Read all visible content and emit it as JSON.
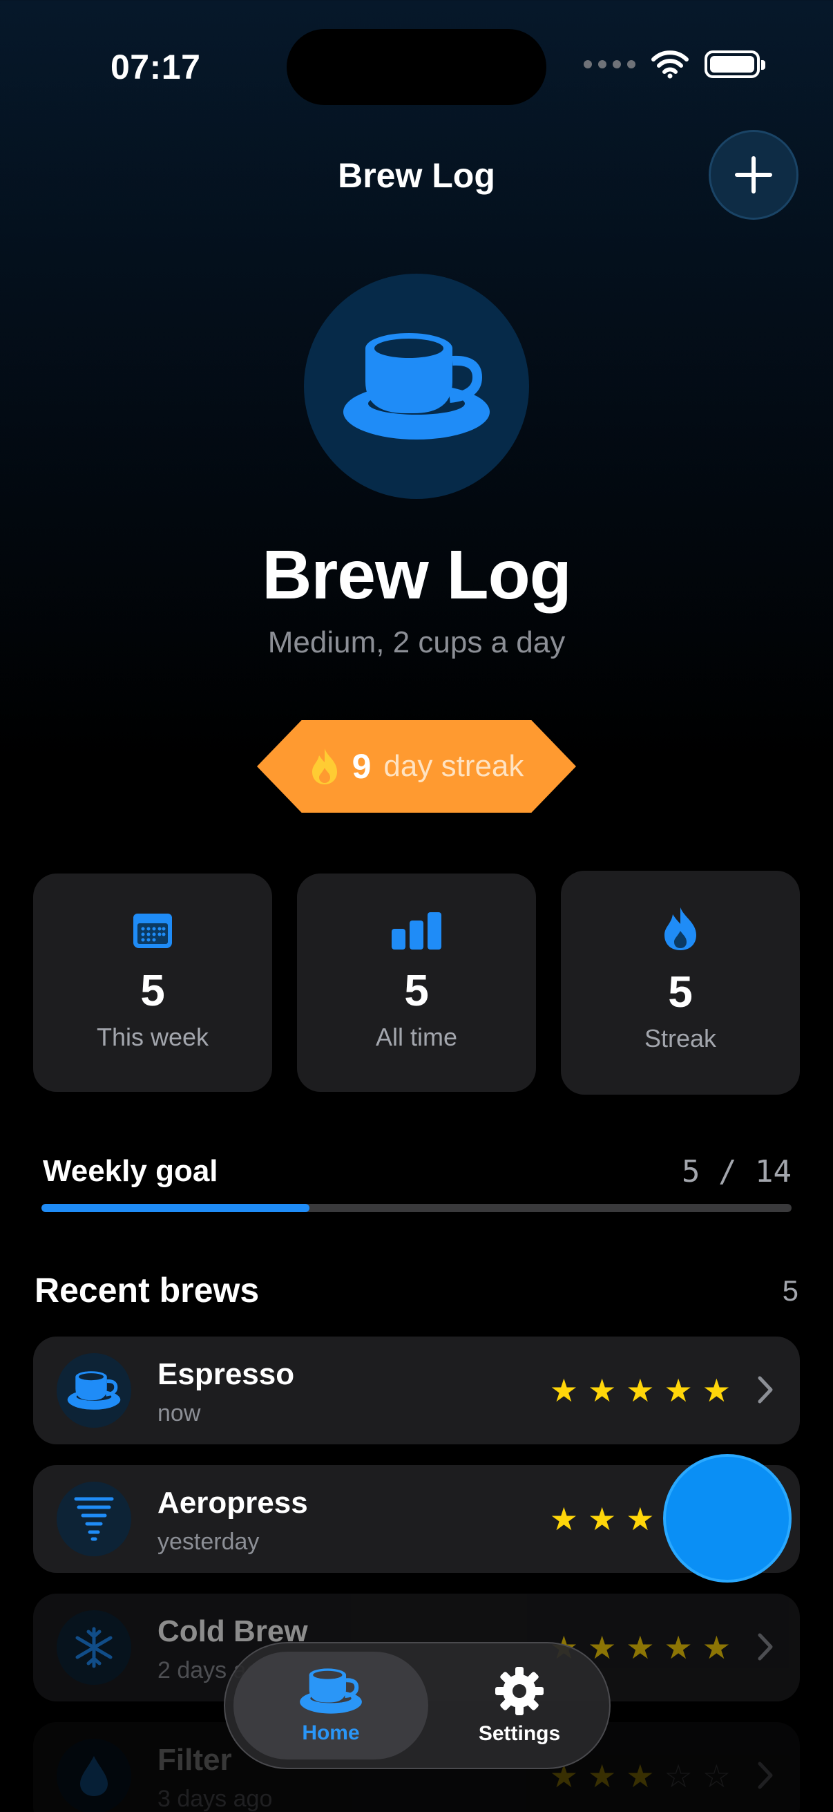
{
  "status_bar": {
    "time": "07:17"
  },
  "nav": {
    "title": "Brew Log",
    "add_icon": "plus-icon"
  },
  "hero": {
    "icon": "coffee-cup-icon",
    "title": "Brew Log",
    "subtitle": "Medium, 2 cups a day"
  },
  "streak_badge": {
    "icon": "flame-icon",
    "count": "9",
    "text": "day streak"
  },
  "stats": [
    {
      "icon": "calendar-icon",
      "value": "5",
      "label": "This week"
    },
    {
      "icon": "bar-chart-icon",
      "value": "5",
      "label": "All time"
    },
    {
      "icon": "flame-icon",
      "value": "5",
      "label": "Streak"
    }
  ],
  "weekly_goal": {
    "label": "Weekly goal",
    "count": "5 / 14",
    "current": 5,
    "target": 14
  },
  "recent": {
    "title": "Recent brews",
    "count": "5",
    "items": [
      {
        "icon": "coffee-cup-icon",
        "name": "Espresso",
        "time": "now",
        "rating": 5
      },
      {
        "icon": "tornado-icon",
        "name": "Aeropress",
        "time": "yesterday",
        "rating": 3
      },
      {
        "icon": "snowflake-icon",
        "name": "Cold Brew",
        "time": "2 days ago",
        "rating": 5
      },
      {
        "icon": "drop-icon",
        "name": "Filter",
        "time": "3 days ago",
        "rating": 3
      }
    ]
  },
  "tabbar": {
    "home": {
      "icon": "coffee-cup-icon",
      "label": "Home"
    },
    "settings": {
      "icon": "gear-icon",
      "label": "Settings"
    }
  },
  "colors": {
    "accent": "#1f8cf7",
    "streak": "#ff9a30",
    "star": "#ffd60a",
    "card": "#1d1d1f"
  }
}
